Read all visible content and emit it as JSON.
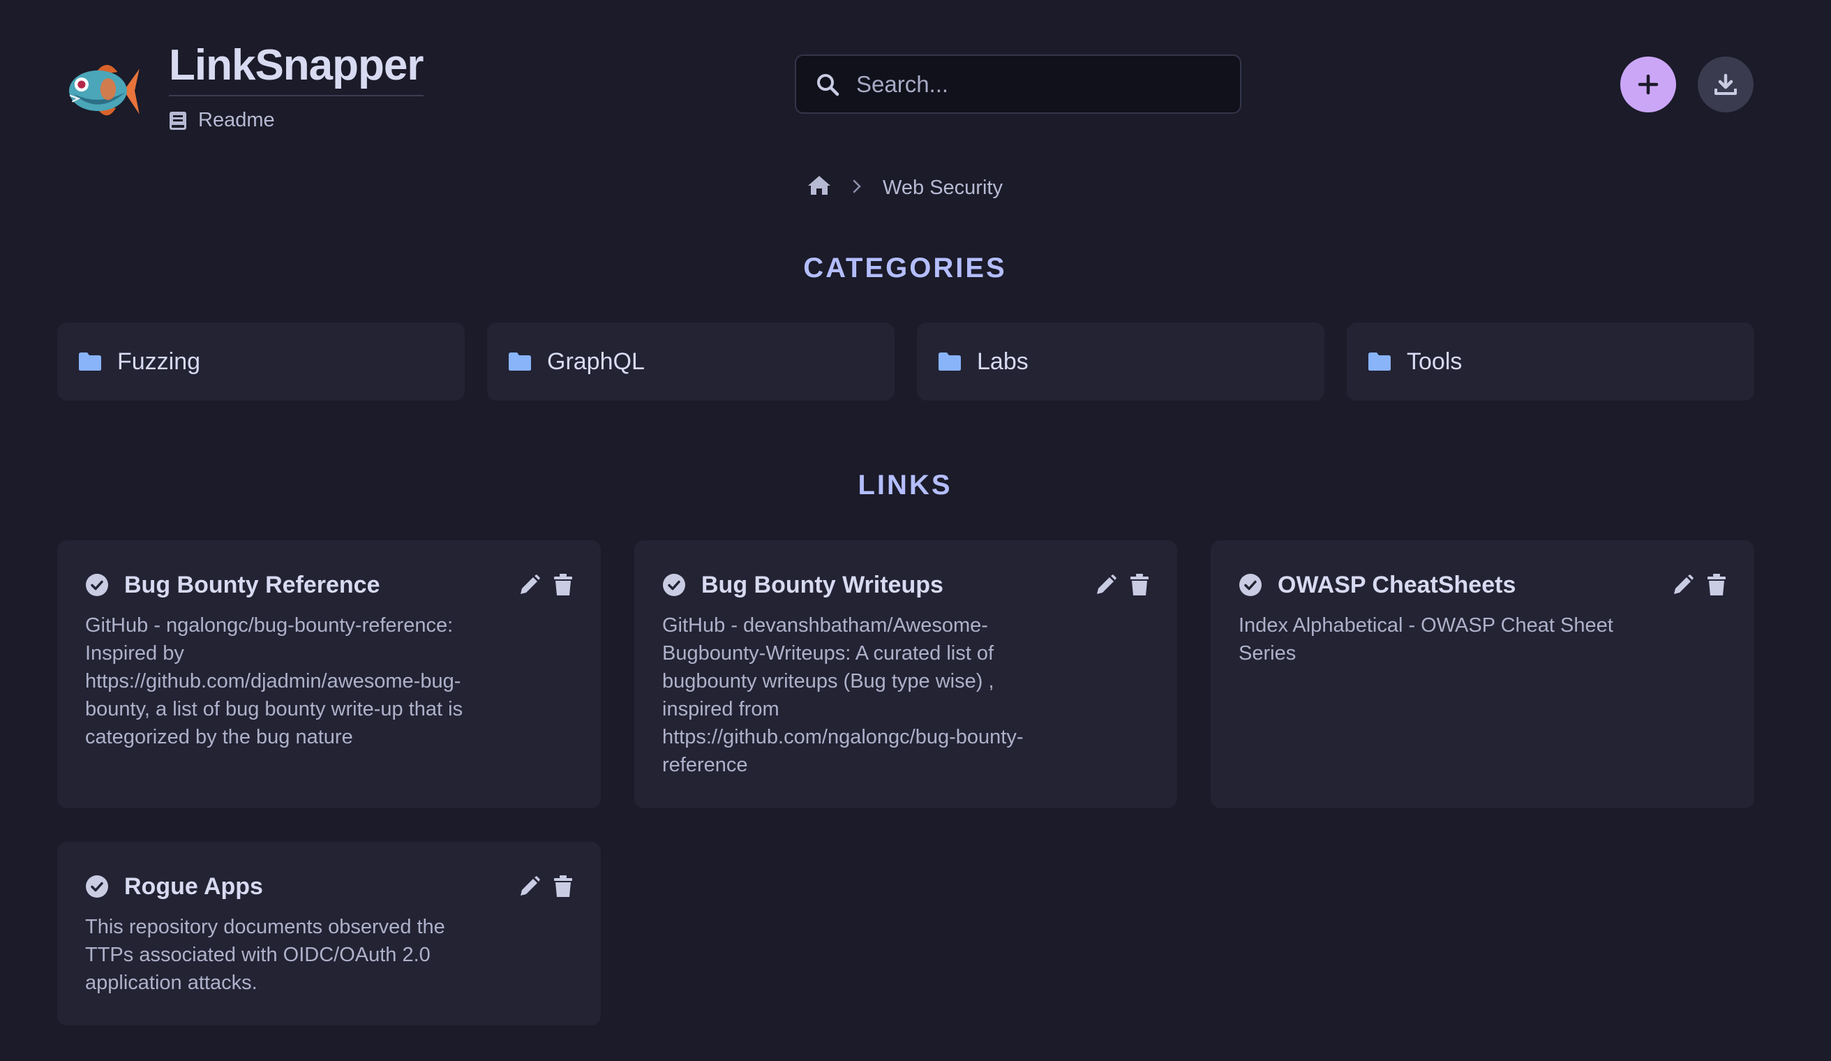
{
  "app": {
    "title": "LinkSnapper",
    "readme_label": "Readme"
  },
  "search": {
    "placeholder": "Search..."
  },
  "colors": {
    "background": "#1b1b29",
    "card": "#232334",
    "accent": "#cba6f7",
    "heading": "#b4befe",
    "folder": "#89b4fa"
  },
  "breadcrumb": {
    "home_icon": "home-icon",
    "current": "Web Security"
  },
  "categories_section": {
    "title": "CATEGORIES",
    "items": [
      {
        "label": "Fuzzing",
        "icon": "folder-icon"
      },
      {
        "label": "GraphQL",
        "icon": "folder-icon"
      },
      {
        "label": "Labs",
        "icon": "folder-icon"
      },
      {
        "label": "Tools",
        "icon": "folder-icon"
      }
    ]
  },
  "links_section": {
    "title": "LINKS",
    "items": [
      {
        "title": "Bug Bounty Reference",
        "description": "GitHub - ngalongc/bug-bounty-reference: Inspired by https://github.com/djadmin/awesome-bug-bounty, a list of bug bounty write-up that is categorized by the bug nature"
      },
      {
        "title": "Bug Bounty Writeups",
        "description": "GitHub - devanshbatham/Awesome-Bugbounty-Writeups: A curated list of bugbounty writeups (Bug type wise) , inspired from https://github.com/ngalongc/bug-bounty-reference"
      },
      {
        "title": "OWASP CheatSheets",
        "description": "Index Alphabetical - OWASP Cheat Sheet Series"
      },
      {
        "title": "Rogue Apps",
        "description": "This repository documents observed the TTPs associated with OIDC/OAuth 2.0 application attacks."
      }
    ]
  }
}
